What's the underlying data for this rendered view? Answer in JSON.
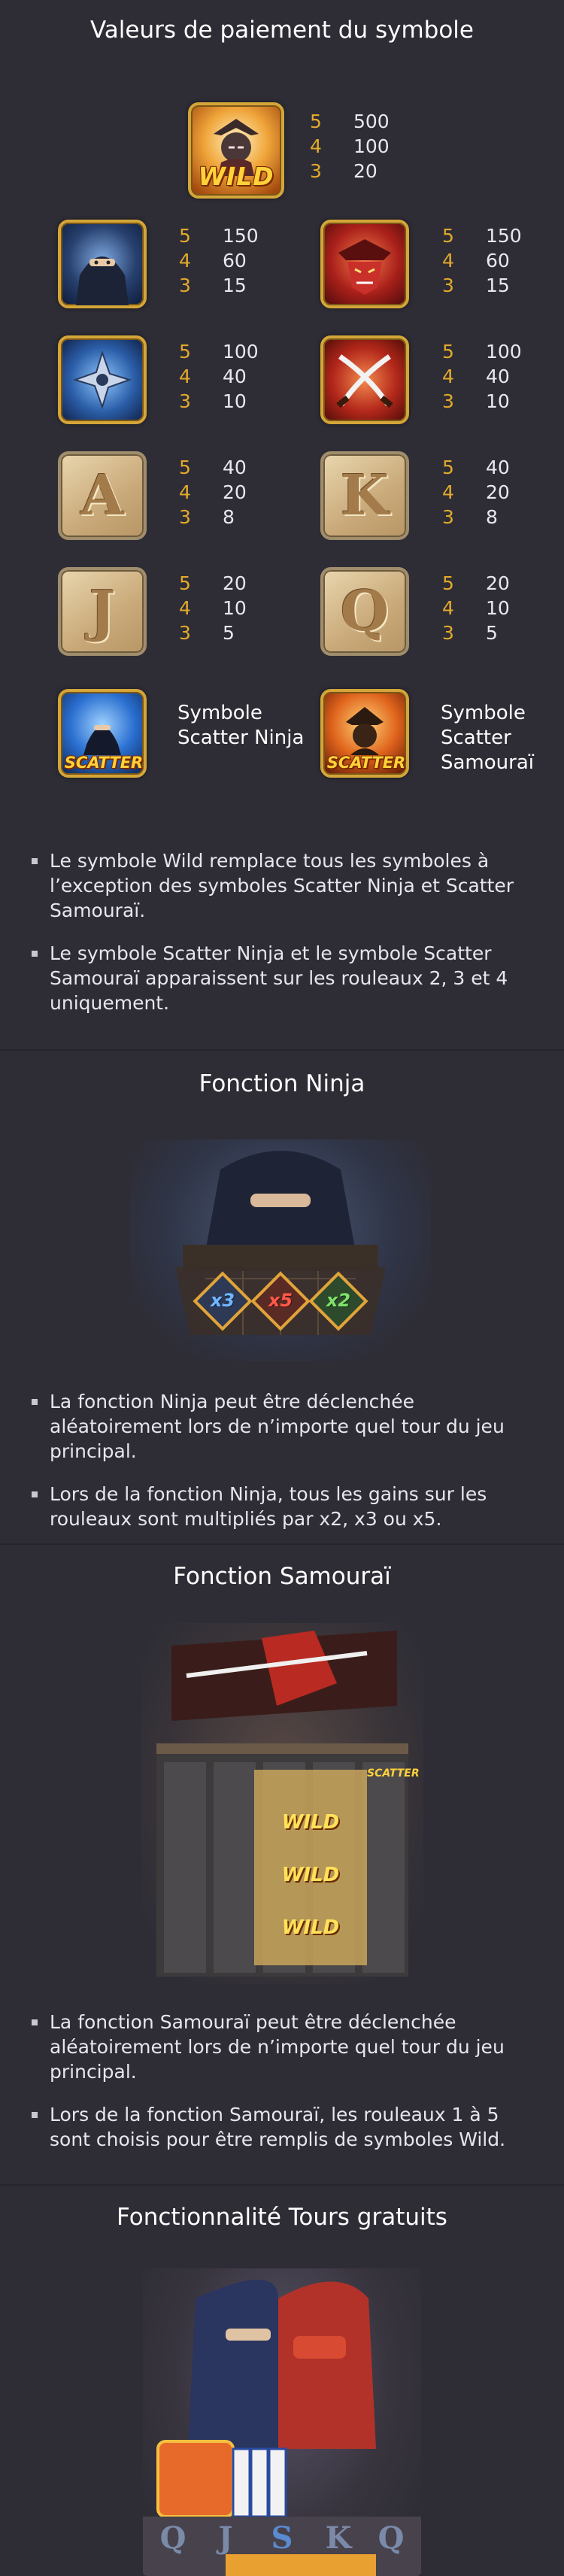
{
  "paytable": {
    "title": "Valeurs de paiement du symbole",
    "wild": {
      "icon": "wild-samurai-icon",
      "label": "WILD",
      "pays": [
        {
          "count": "5",
          "value": "500"
        },
        {
          "count": "4",
          "value": "100"
        },
        {
          "count": "3",
          "value": "20"
        }
      ]
    },
    "symbols": [
      {
        "icon": "ninja-icon",
        "pays": [
          {
            "count": "5",
            "value": "150"
          },
          {
            "count": "4",
            "value": "60"
          },
          {
            "count": "3",
            "value": "15"
          }
        ]
      },
      {
        "icon": "samurai-mask-icon",
        "pays": [
          {
            "count": "5",
            "value": "150"
          },
          {
            "count": "4",
            "value": "60"
          },
          {
            "count": "3",
            "value": "15"
          }
        ]
      },
      {
        "icon": "shuriken-icon",
        "pays": [
          {
            "count": "5",
            "value": "100"
          },
          {
            "count": "4",
            "value": "40"
          },
          {
            "count": "3",
            "value": "10"
          }
        ]
      },
      {
        "icon": "crossed-swords-icon",
        "pays": [
          {
            "count": "5",
            "value": "100"
          },
          {
            "count": "4",
            "value": "40"
          },
          {
            "count": "3",
            "value": "10"
          }
        ]
      },
      {
        "icon": "letter-a-icon",
        "letter": "A",
        "pays": [
          {
            "count": "5",
            "value": "40"
          },
          {
            "count": "4",
            "value": "20"
          },
          {
            "count": "3",
            "value": "8"
          }
        ]
      },
      {
        "icon": "letter-k-icon",
        "letter": "K",
        "pays": [
          {
            "count": "5",
            "value": "40"
          },
          {
            "count": "4",
            "value": "20"
          },
          {
            "count": "3",
            "value": "8"
          }
        ]
      },
      {
        "icon": "letter-j-icon",
        "letter": "J",
        "pays": [
          {
            "count": "5",
            "value": "20"
          },
          {
            "count": "4",
            "value": "10"
          },
          {
            "count": "3",
            "value": "5"
          }
        ]
      },
      {
        "icon": "letter-q-icon",
        "letter": "Q",
        "pays": [
          {
            "count": "5",
            "value": "20"
          },
          {
            "count": "4",
            "value": "10"
          },
          {
            "count": "3",
            "value": "5"
          }
        ]
      }
    ],
    "scatters": [
      {
        "icon": "scatter-ninja-icon",
        "label": "SCATTER",
        "name": "Symbole Scatter Ninja"
      },
      {
        "icon": "scatter-samurai-icon",
        "label": "SCATTER",
        "name": "Symbole Scatter Samouraï"
      }
    ],
    "rules": [
      "Le symbole Wild remplace tous les symboles à l’exception des symboles Scatter Ninja et Scatter Samouraï.",
      "Le symbole Scatter Ninja et le symbole Scatter Samouraï apparaissent sur les rouleaux 2, 3 et 4 uniquement."
    ]
  },
  "ninja_feature": {
    "title": "Fonction Ninja",
    "art_icon": "ninja-feature-illustration",
    "multipliers": [
      "x3",
      "x5",
      "x2"
    ],
    "bullets": [
      "La fonction Ninja peut être déclenchée aléatoirement lors de n’importe quel tour du jeu principal.",
      "Lors de la fonction Ninja, tous les gains sur les rouleaux sont multipliés par x2, x3 ou x5."
    ]
  },
  "samurai_feature": {
    "title": "Fonction Samouraï",
    "art_icon": "samurai-feature-illustration",
    "wild_label": "WILD",
    "scatter_label": "SCATTER",
    "bullets": [
      "La fonction Samouraï peut être déclenchée aléatoirement lors de n’importe quel tour du jeu principal.",
      "Lors de la fonction Samouraï, les rouleaux 1 à 5 sont choisis pour être remplis de symboles Wild."
    ]
  },
  "free_spins": {
    "title": "Fonctionnalité Tours gratuits",
    "art_icon": "free-spins-illustration",
    "reel_letters": [
      "Q",
      "J",
      "S",
      "K",
      "Q"
    ]
  },
  "colors": {
    "background": "#2e2d36",
    "count": "#e2a92b",
    "text": "#e4e4ea",
    "gold_frame": "#d4a538"
  }
}
